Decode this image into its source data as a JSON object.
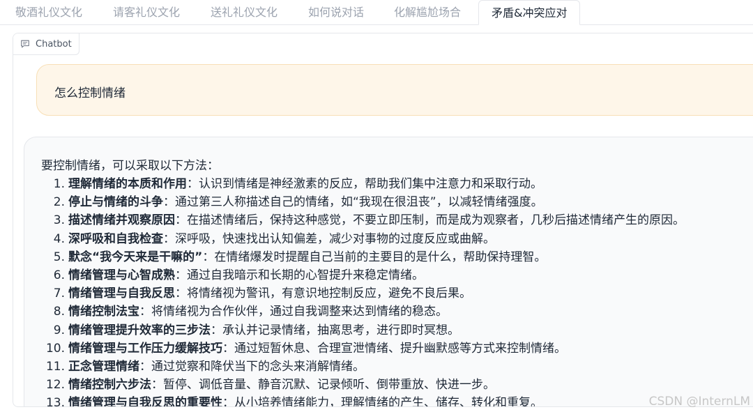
{
  "tabs": [
    {
      "label": "敬酒礼仪文化",
      "active": false
    },
    {
      "label": "请客礼仪文化",
      "active": false
    },
    {
      "label": "送礼礼仪文化",
      "active": false
    },
    {
      "label": "如何说对话",
      "active": false
    },
    {
      "label": "化解尴尬场合",
      "active": false
    },
    {
      "label": "矛盾&冲突应对",
      "active": true
    }
  ],
  "chatbot": {
    "label": "Chatbot",
    "icon": "chat-icon"
  },
  "user_message": "怎么控制情绪",
  "bot_message": {
    "intro": "要控制情绪，可以采取以下方法：",
    "items": [
      {
        "num": "1.",
        "title": "理解情绪的本质和作用",
        "text": "：认识到情绪是神经激素的反应，帮助我们集中注意力和采取行动。"
      },
      {
        "num": "2.",
        "title": "停止与情绪的斗争",
        "text": "：通过第三人称描述自己的情绪，如“我现在很沮丧”，以减轻情绪强度。"
      },
      {
        "num": "3.",
        "title": "描述情绪并观察原因",
        "text": "：在描述情绪后，保持这种感觉，不要立即压制，而是成为观察者，几秒后描述情绪产生的原因。"
      },
      {
        "num": "4.",
        "title": "深呼吸和自我检查",
        "text": "：深呼吸，快速找出认知偏差，减少对事物的过度反应或曲解。"
      },
      {
        "num": "5.",
        "title": "默念“我今天来是干嘛的”",
        "text": "：在情绪爆发时提醒自己当前的主要目的是什么，帮助保持理智。"
      },
      {
        "num": "6.",
        "title": "情绪管理与心智成熟",
        "text": "：通过自我暗示和长期的心智提升来稳定情绪。"
      },
      {
        "num": "7.",
        "title": "情绪管理与自我反思",
        "text": "：将情绪视为警讯，有意识地控制反应，避免不良后果。"
      },
      {
        "num": "8.",
        "title": "情绪控制法宝",
        "text": "：将情绪视为合作伙伴，通过自我调整来达到情绪的稳态。"
      },
      {
        "num": "9.",
        "title": "情绪管理提升效率的三步法",
        "text": "：承认并记录情绪，抽离思考，进行即时冥想。"
      },
      {
        "num": "10.",
        "title": "情绪管理与工作压力缓解技巧",
        "text": "：通过短暂休息、合理宣泄情绪、提升幽默感等方式来控制情绪。"
      },
      {
        "num": "11.",
        "title": "正念管理情绪",
        "text": "：通过觉察和降伏当下的念头来消解情绪。"
      },
      {
        "num": "12.",
        "title": "情绪控制六步法",
        "text": "：暂停、调低音量、静音沉默、记录倾听、倒带重放、快进一步。"
      },
      {
        "num": "13.",
        "title": "情绪管理与自我反思的重要性",
        "text": "：从小培养情绪能力，理解情绪的产生、储存、转化和重复。"
      }
    ]
  },
  "watermark": "CSDN @InternLM"
}
